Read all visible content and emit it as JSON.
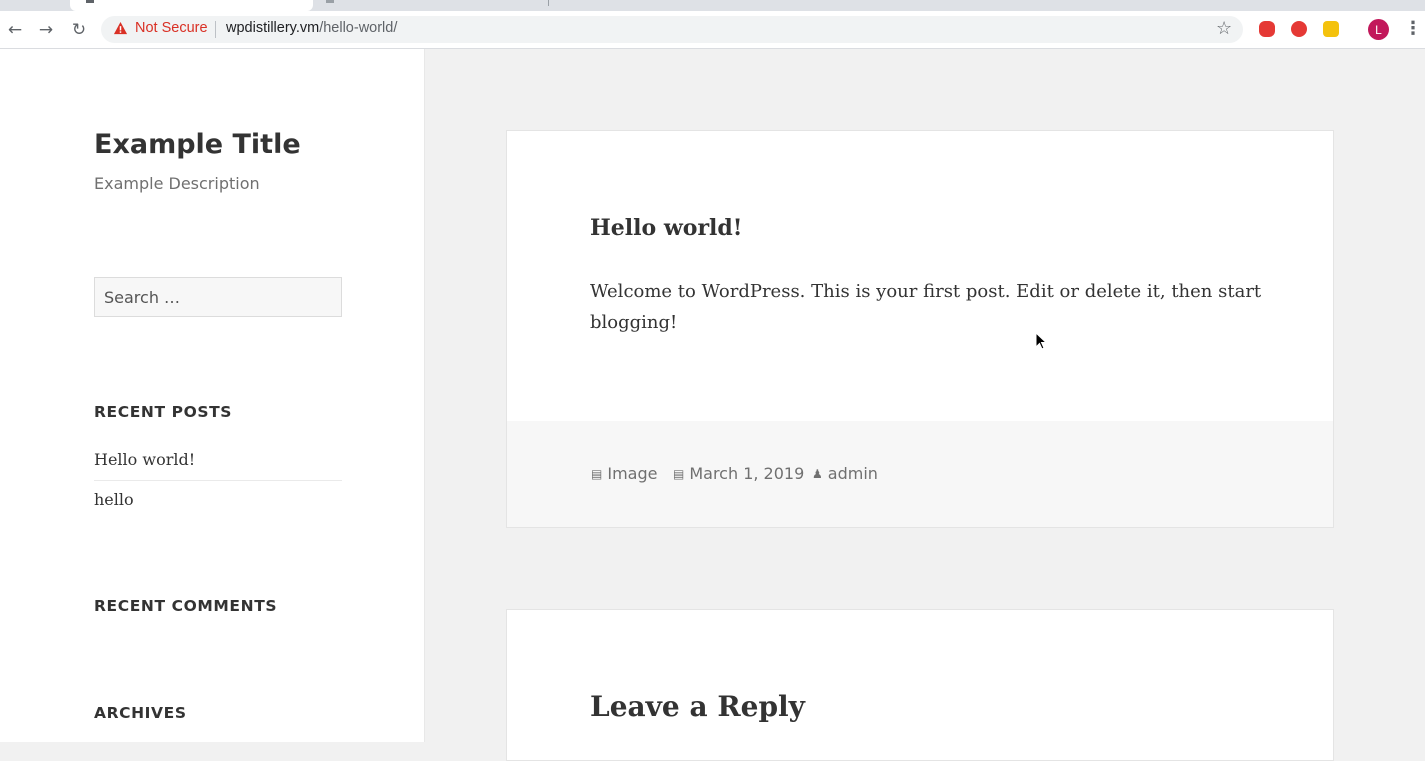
{
  "browser": {
    "security_label": "Not Secure",
    "url_host": "wpdistillery.vm",
    "url_path": "/hello-world/",
    "profile_initial": "L",
    "icons": [
      "back-arrow-icon",
      "forward-arrow-icon",
      "reload-icon",
      "warning-icon",
      "star-icon",
      "extension-icon",
      "kebab-menu-icon"
    ],
    "colors": {
      "warning": "#d93025",
      "avatar": "#c2185b"
    }
  },
  "site": {
    "title": "Example Title",
    "description": "Example Description"
  },
  "sidebar": {
    "search_placeholder": "Search …",
    "recent_posts_heading": "RECENT POSTS",
    "recent_posts": [
      "Hello world!",
      "hello"
    ],
    "recent_comments_heading": "RECENT COMMENTS",
    "archives_heading": "ARCHIVES"
  },
  "post": {
    "title": "Hello world!",
    "body": "Welcome to WordPress. This is your first post. Edit or delete it, then start blogging!",
    "format": "Image",
    "date": "March 1, 2019",
    "author": "admin"
  },
  "comments": {
    "heading": "Leave a Reply"
  }
}
